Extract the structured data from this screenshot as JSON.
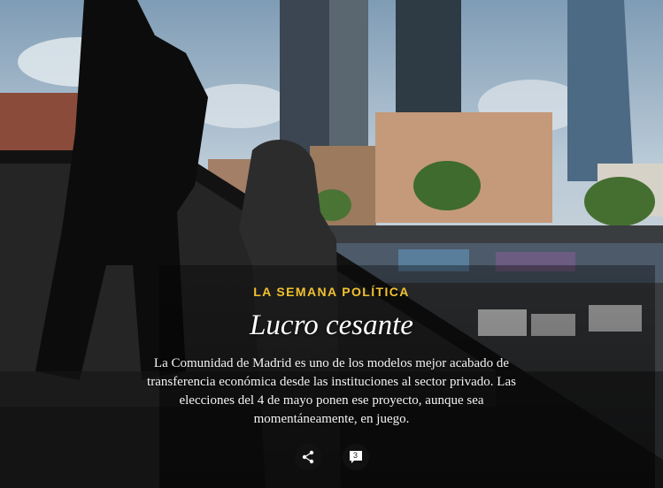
{
  "article": {
    "kicker": "LA SEMANA POLÍTICA",
    "headline": "Lucro cesante",
    "summary": "La Comunidad de Madrid es uno de los modelos mejor acabado de transferencia económica desde las instituciones al sector privado. Las elecciones del 4 de mayo ponen ese proyecto, aunque sea momentáneamente, en juego."
  },
  "actions": {
    "share_icon": "share-icon",
    "comments_icon": "comment-icon",
    "comment_count": "3"
  },
  "colors": {
    "kicker": "#f2c12e",
    "headline": "#ffffff",
    "body_text": "#f5f5f5"
  }
}
